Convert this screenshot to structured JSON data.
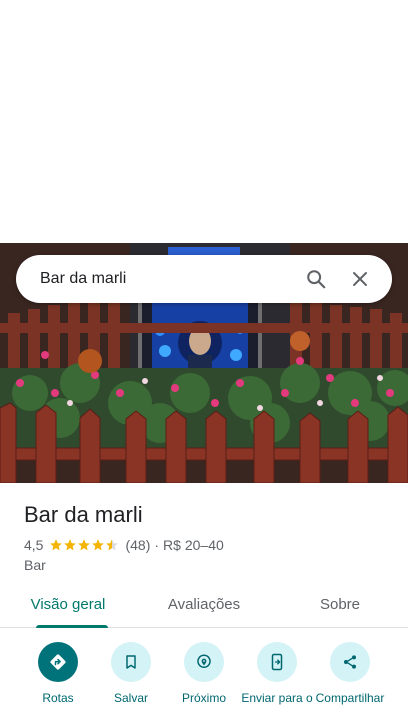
{
  "search": {
    "query": "Bar da marli"
  },
  "place": {
    "name": "Bar da marli",
    "rating": "4,5",
    "review_count": "(48)",
    "separator": "·",
    "price": "R$ 20–40",
    "category": "Bar",
    "stars_value": 4.5
  },
  "tabs": [
    {
      "label": "Visão geral",
      "active": true
    },
    {
      "label": "Avaliações",
      "active": false
    },
    {
      "label": "Sobre",
      "active": false
    }
  ],
  "actions": [
    {
      "label": "Rotas",
      "icon": "directions-icon"
    },
    {
      "label": "Salvar",
      "icon": "bookmark-icon"
    },
    {
      "label": "Próximo",
      "icon": "nearby-icon"
    },
    {
      "label": "Enviar para o",
      "icon": "send-to-phone-icon"
    },
    {
      "label": "Compartilhar",
      "icon": "share-icon"
    }
  ],
  "colors": {
    "accent": "#00796b",
    "primary_action": "#00727a",
    "action_bg": "#d4f3f7",
    "star": "#f4b400"
  }
}
